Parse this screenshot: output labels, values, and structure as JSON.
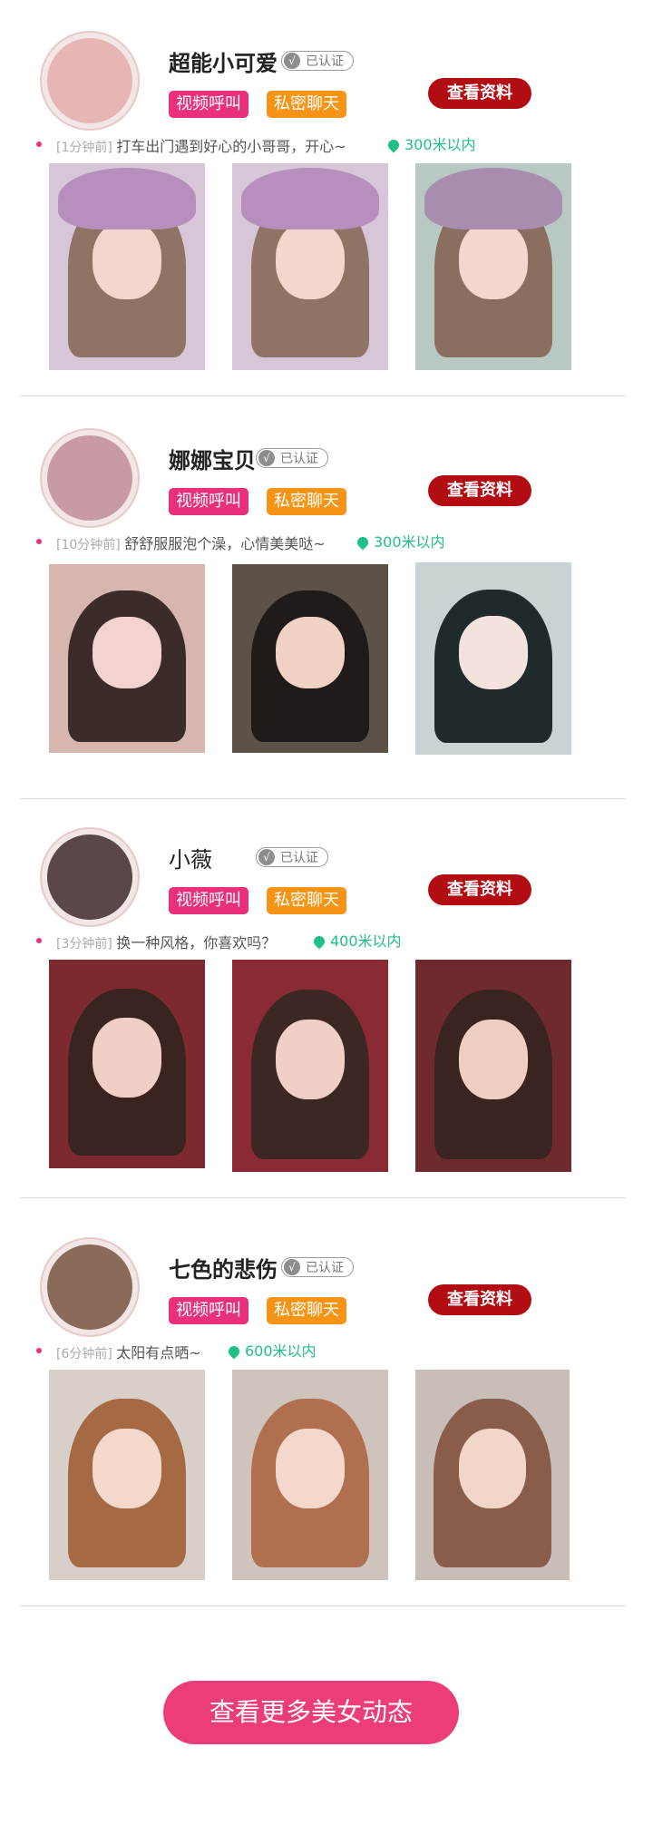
{
  "common": {
    "verified_label": "已认证",
    "video_call_label": "视频呼叫",
    "private_chat_label": "私密聊天",
    "view_profile_label": "查看资料",
    "check_glyph": "√"
  },
  "users": [
    {
      "name": "超能小可爱",
      "time": "[1分钟前]",
      "status": "打车出门遇到好心的小哥哥，开心~",
      "distance": "300米以内",
      "avatar_color": "#e8b5b5",
      "photo_colors": [
        "#c9a6c9",
        "#b898c0",
        "#a9b9b3"
      ]
    },
    {
      "name": "娜娜宝贝",
      "time": "[10分钟前]",
      "status": "舒舒服服泡个澡，心情美美哒~",
      "distance": "300米以内",
      "avatar_color": "#c79aa4",
      "photo_colors": [
        "#d8b6b0",
        "#3a3330",
        "#c8d3d3"
      ]
    },
    {
      "name": "小薇",
      "time": "[3分钟前]",
      "status": "换一种风格，你喜欢吗？",
      "distance": "400米以内",
      "avatar_color": "#5a4848",
      "photo_colors": [
        "#7c2a30",
        "#8a2a35",
        "#6e2a2e"
      ]
    },
    {
      "name": "七色的悲伤",
      "time": "[6分钟前]",
      "status": "太阳有点晒~",
      "distance": "600米以内",
      "avatar_color": "#8a6a58",
      "photo_colors": [
        "#a86a4a",
        "#b07050",
        "#8a5d4a"
      ]
    }
  ],
  "footer": {
    "more_label": "查看更多美女动态",
    "accent_color": "#ec3d79"
  }
}
